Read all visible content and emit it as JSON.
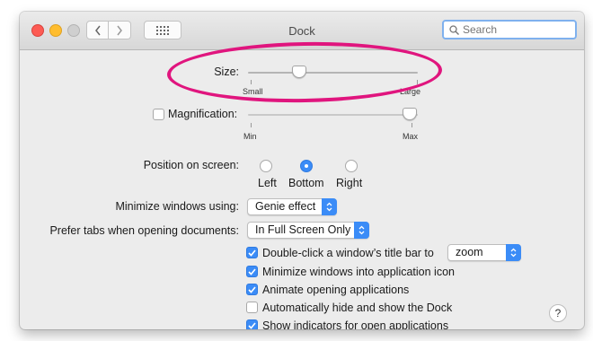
{
  "window": {
    "title": "Dock",
    "search_placeholder": "Search"
  },
  "size": {
    "label": "Size:",
    "min_label": "Small",
    "max_label": "Large",
    "value": 0.3
  },
  "magnification": {
    "label": "Magnification:",
    "checked": false,
    "min_label": "Min",
    "max_label": "Max",
    "value": 1.0
  },
  "position": {
    "label": "Position on screen:",
    "options": [
      "Left",
      "Bottom",
      "Right"
    ],
    "selected": "Bottom"
  },
  "minimize": {
    "label": "Minimize windows using:",
    "value": "Genie effect"
  },
  "prefer_tabs": {
    "label": "Prefer tabs when opening documents:",
    "value": "In Full Screen Only"
  },
  "options": {
    "double_click_label": "Double-click a window’s title bar to",
    "double_click_value": "zoom",
    "minimize_into_icon": "Minimize windows into application icon",
    "animate": "Animate opening applications",
    "autohide": "Automatically hide and show the Dock",
    "indicators": "Show indicators for open applications"
  },
  "help": {
    "label": "?"
  },
  "colors": {
    "accent": "#3b8cf7",
    "annotation": "#e0157e"
  }
}
